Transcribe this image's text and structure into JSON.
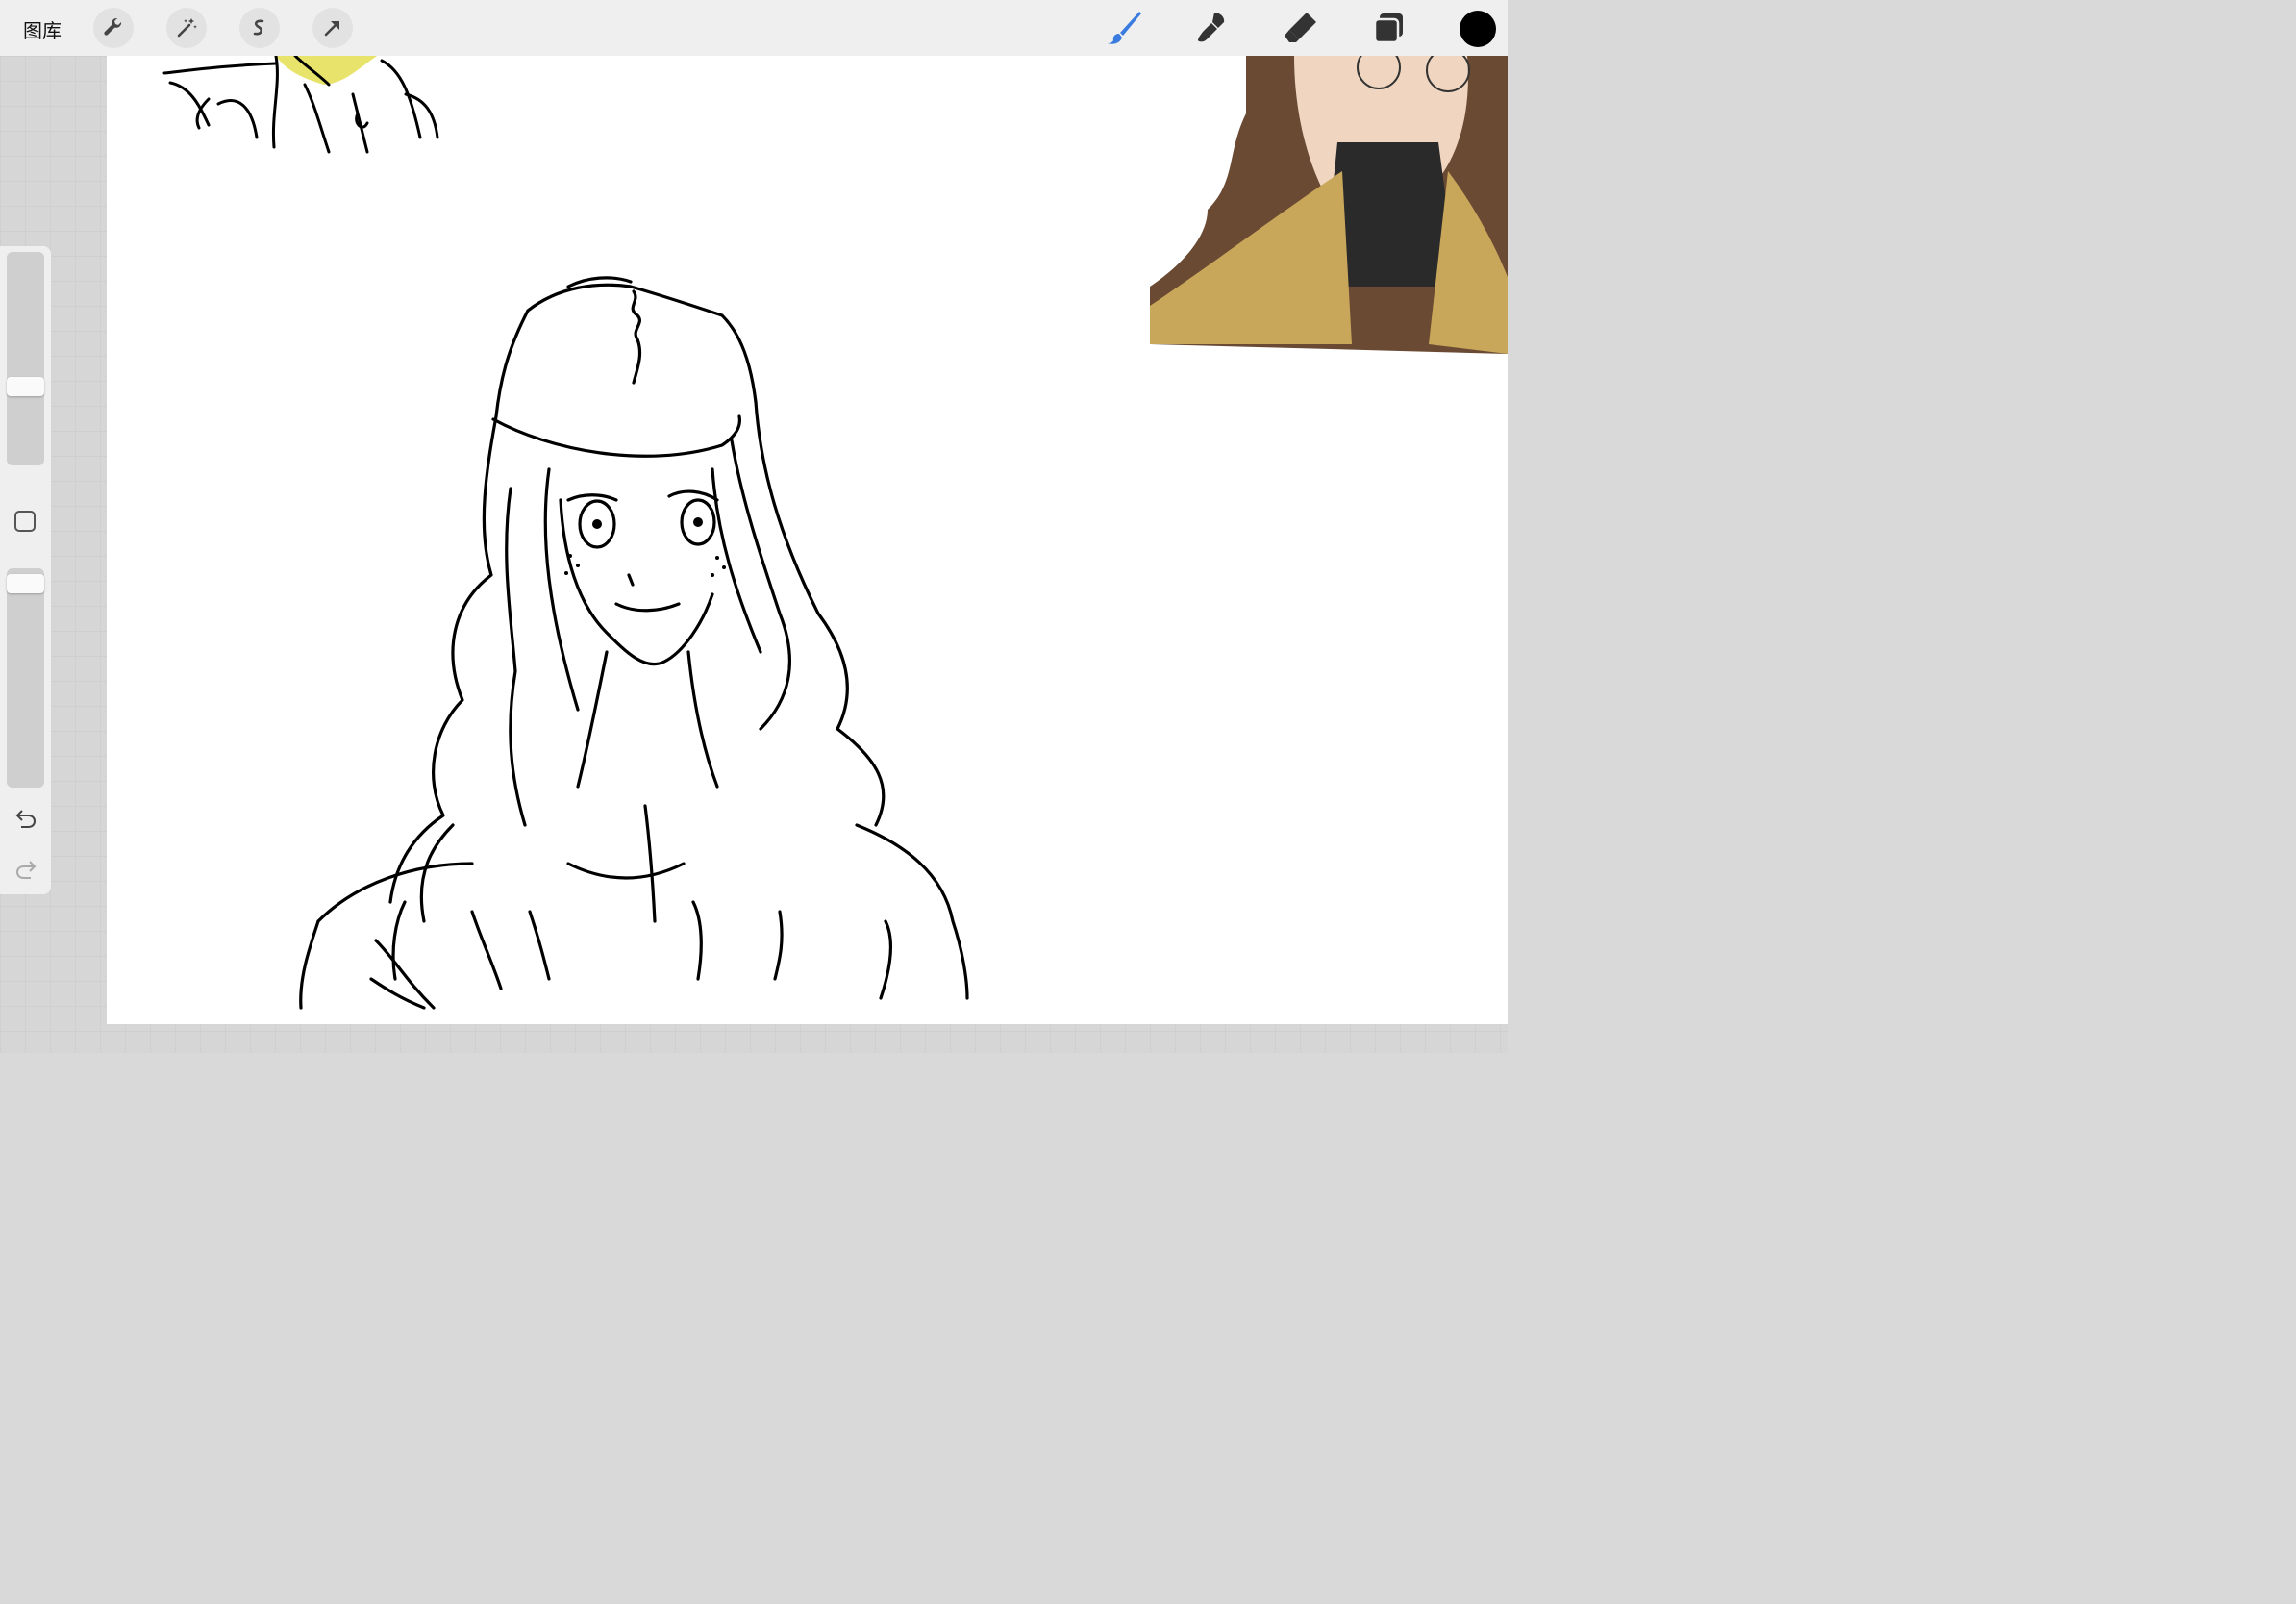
{
  "toolbar": {
    "gallery_label": "图库",
    "left_tools": [
      "wrench-icon",
      "magic-wand-icon",
      "selection-icon",
      "transform-arrow-icon"
    ],
    "right_tools": [
      "brush-icon",
      "smudge-icon",
      "eraser-icon",
      "layers-icon"
    ],
    "current_color": "#000000",
    "active_tool_color": "#3a7be0"
  },
  "sidebar": {
    "brush_size_level": 0.6,
    "opacity_level": 0.95,
    "controls": [
      "brush-size-slider",
      "modify-button",
      "opacity-slider",
      "undo-icon",
      "redo-icon"
    ]
  },
  "canvas": {
    "background": "#ffffff",
    "content": [
      "sketch-top-left",
      "reference-image",
      "character-sketch"
    ]
  }
}
